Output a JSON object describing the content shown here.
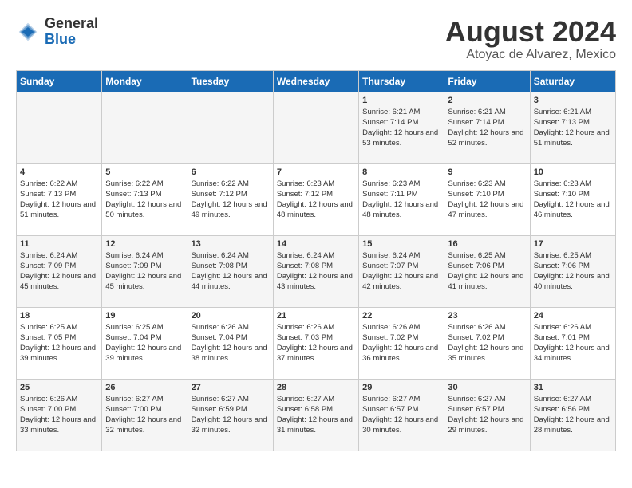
{
  "header": {
    "logo_general": "General",
    "logo_blue": "Blue",
    "month_year": "August 2024",
    "location": "Atoyac de Alvarez, Mexico"
  },
  "days_of_week": [
    "Sunday",
    "Monday",
    "Tuesday",
    "Wednesday",
    "Thursday",
    "Friday",
    "Saturday"
  ],
  "weeks": [
    [
      {
        "day": "",
        "info": ""
      },
      {
        "day": "",
        "info": ""
      },
      {
        "day": "",
        "info": ""
      },
      {
        "day": "",
        "info": ""
      },
      {
        "day": "1",
        "info": "Sunrise: 6:21 AM\nSunset: 7:14 PM\nDaylight: 12 hours\nand 53 minutes."
      },
      {
        "day": "2",
        "info": "Sunrise: 6:21 AM\nSunset: 7:14 PM\nDaylight: 12 hours\nand 52 minutes."
      },
      {
        "day": "3",
        "info": "Sunrise: 6:21 AM\nSunset: 7:13 PM\nDaylight: 12 hours\nand 51 minutes."
      }
    ],
    [
      {
        "day": "4",
        "info": "Sunrise: 6:22 AM\nSunset: 7:13 PM\nDaylight: 12 hours\nand 51 minutes."
      },
      {
        "day": "5",
        "info": "Sunrise: 6:22 AM\nSunset: 7:13 PM\nDaylight: 12 hours\nand 50 minutes."
      },
      {
        "day": "6",
        "info": "Sunrise: 6:22 AM\nSunset: 7:12 PM\nDaylight: 12 hours\nand 49 minutes."
      },
      {
        "day": "7",
        "info": "Sunrise: 6:23 AM\nSunset: 7:12 PM\nDaylight: 12 hours\nand 48 minutes."
      },
      {
        "day": "8",
        "info": "Sunrise: 6:23 AM\nSunset: 7:11 PM\nDaylight: 12 hours\nand 48 minutes."
      },
      {
        "day": "9",
        "info": "Sunrise: 6:23 AM\nSunset: 7:10 PM\nDaylight: 12 hours\nand 47 minutes."
      },
      {
        "day": "10",
        "info": "Sunrise: 6:23 AM\nSunset: 7:10 PM\nDaylight: 12 hours\nand 46 minutes."
      }
    ],
    [
      {
        "day": "11",
        "info": "Sunrise: 6:24 AM\nSunset: 7:09 PM\nDaylight: 12 hours\nand 45 minutes."
      },
      {
        "day": "12",
        "info": "Sunrise: 6:24 AM\nSunset: 7:09 PM\nDaylight: 12 hours\nand 45 minutes."
      },
      {
        "day": "13",
        "info": "Sunrise: 6:24 AM\nSunset: 7:08 PM\nDaylight: 12 hours\nand 44 minutes."
      },
      {
        "day": "14",
        "info": "Sunrise: 6:24 AM\nSunset: 7:08 PM\nDaylight: 12 hours\nand 43 minutes."
      },
      {
        "day": "15",
        "info": "Sunrise: 6:24 AM\nSunset: 7:07 PM\nDaylight: 12 hours\nand 42 minutes."
      },
      {
        "day": "16",
        "info": "Sunrise: 6:25 AM\nSunset: 7:06 PM\nDaylight: 12 hours\nand 41 minutes."
      },
      {
        "day": "17",
        "info": "Sunrise: 6:25 AM\nSunset: 7:06 PM\nDaylight: 12 hours\nand 40 minutes."
      }
    ],
    [
      {
        "day": "18",
        "info": "Sunrise: 6:25 AM\nSunset: 7:05 PM\nDaylight: 12 hours\nand 39 minutes."
      },
      {
        "day": "19",
        "info": "Sunrise: 6:25 AM\nSunset: 7:04 PM\nDaylight: 12 hours\nand 39 minutes."
      },
      {
        "day": "20",
        "info": "Sunrise: 6:26 AM\nSunset: 7:04 PM\nDaylight: 12 hours\nand 38 minutes."
      },
      {
        "day": "21",
        "info": "Sunrise: 6:26 AM\nSunset: 7:03 PM\nDaylight: 12 hours\nand 37 minutes."
      },
      {
        "day": "22",
        "info": "Sunrise: 6:26 AM\nSunset: 7:02 PM\nDaylight: 12 hours\nand 36 minutes."
      },
      {
        "day": "23",
        "info": "Sunrise: 6:26 AM\nSunset: 7:02 PM\nDaylight: 12 hours\nand 35 minutes."
      },
      {
        "day": "24",
        "info": "Sunrise: 6:26 AM\nSunset: 7:01 PM\nDaylight: 12 hours\nand 34 minutes."
      }
    ],
    [
      {
        "day": "25",
        "info": "Sunrise: 6:26 AM\nSunset: 7:00 PM\nDaylight: 12 hours\nand 33 minutes."
      },
      {
        "day": "26",
        "info": "Sunrise: 6:27 AM\nSunset: 7:00 PM\nDaylight: 12 hours\nand 32 minutes."
      },
      {
        "day": "27",
        "info": "Sunrise: 6:27 AM\nSunset: 6:59 PM\nDaylight: 12 hours\nand 32 minutes."
      },
      {
        "day": "28",
        "info": "Sunrise: 6:27 AM\nSunset: 6:58 PM\nDaylight: 12 hours\nand 31 minutes."
      },
      {
        "day": "29",
        "info": "Sunrise: 6:27 AM\nSunset: 6:57 PM\nDaylight: 12 hours\nand 30 minutes."
      },
      {
        "day": "30",
        "info": "Sunrise: 6:27 AM\nSunset: 6:57 PM\nDaylight: 12 hours\nand 29 minutes."
      },
      {
        "day": "31",
        "info": "Sunrise: 6:27 AM\nSunset: 6:56 PM\nDaylight: 12 hours\nand 28 minutes."
      }
    ]
  ]
}
